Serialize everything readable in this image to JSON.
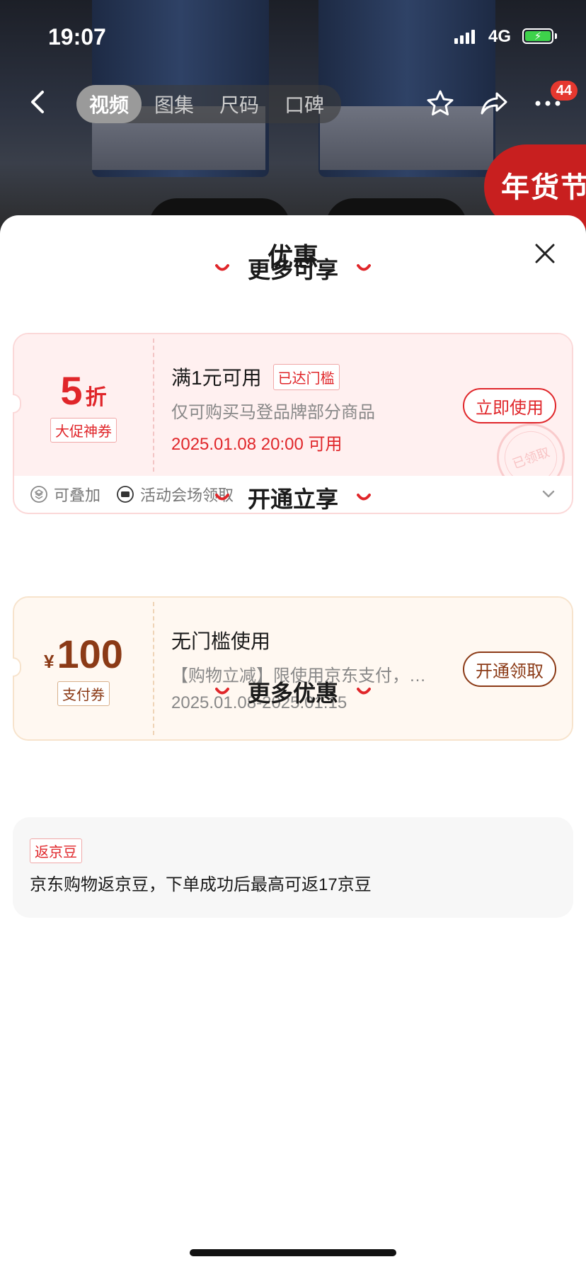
{
  "status_bar": {
    "time": "19:07",
    "network": "4G"
  },
  "nav": {
    "tabs": [
      {
        "label": "视频",
        "active": true
      },
      {
        "label": "图集",
        "active": false
      },
      {
        "label": "尺码",
        "active": false
      },
      {
        "label": "口碑",
        "active": false
      }
    ],
    "more_badge": "44",
    "festival_badge": "年货节",
    "icons": [
      "back-icon",
      "star-icon",
      "share-icon",
      "more-icon"
    ]
  },
  "sheet": {
    "title": "优惠",
    "sections": [
      {
        "heading": "更多可享",
        "coupon": {
          "value_main": "5",
          "value_unit": "折",
          "type_tag": "大促神券",
          "condition": "满1元可用",
          "threshold_tag": "已达门槛",
          "description": "仅可购买马登品牌部分商品",
          "time": "2025.01.08 20:00 可用",
          "button": "立即使用",
          "stamp": "已领取",
          "footer": [
            {
              "icon": "stack-icon",
              "label": "可叠加"
            },
            {
              "icon": "ticket-icon",
              "label": "活动会场领取"
            }
          ]
        }
      },
      {
        "heading": "开通立享",
        "coupon": {
          "currency": "¥",
          "value_main": "100",
          "type_tag": "支付券",
          "condition": "无门槛使用",
          "description": "【购物立减】限使用京东支付，…",
          "time": "2025.01.08-2025.01.15",
          "button": "开通领取"
        }
      },
      {
        "heading": "更多优惠",
        "bean": {
          "tag": "返京豆",
          "text": "京东购物返京豆，下单成功后最高可返17京豆"
        }
      }
    ]
  },
  "colors": {
    "accent_red": "#e0262a",
    "gold_brown": "#8b3a16",
    "battery_green": "#3ed24b"
  }
}
